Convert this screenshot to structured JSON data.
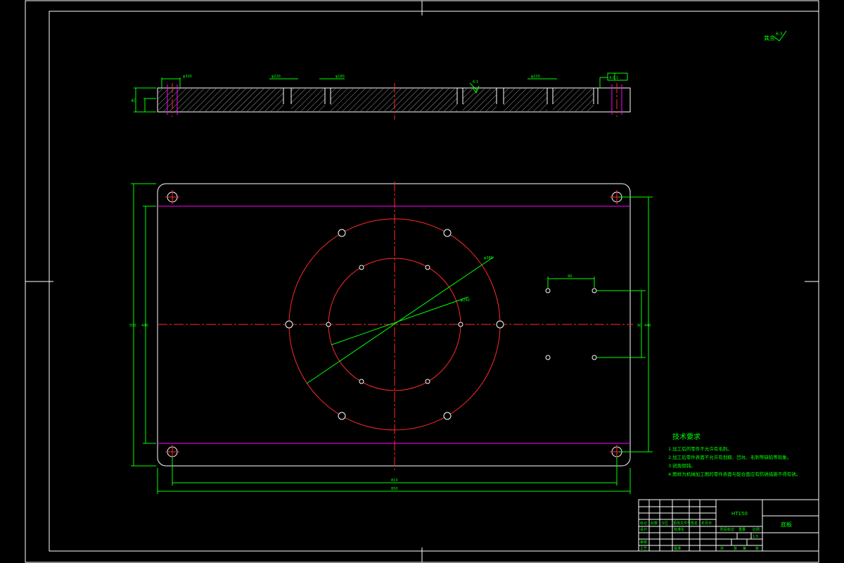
{
  "drawing": {
    "roughness_note": "其余",
    "roughness_value": "6.3",
    "datum_label": "A",
    "tolerance_labels": [
      "φ300",
      "φ220",
      "φ160",
      "6.3",
      "φ220",
      "A 0.1"
    ],
    "hole_dims": {
      "outer_circle": "φ380",
      "inner_circle": "φ240",
      "rect_hole_spacing": "90",
      "rect_hole_height": "90"
    },
    "overall_dims": {
      "width_inner": "810",
      "width_outer": "850",
      "height_left_outer": "500",
      "height_left_inner": "440",
      "height_right": "440"
    },
    "section_height": "40"
  },
  "tech_requirements": {
    "title": "技术要求",
    "items": [
      "1.加工后的零件不允许有毛刺。",
      "2.加工后零件表面不允许有划痕、凹坑、毛刺等缺陷等现象。",
      "3.锐角倒钝。",
      "4.图样为机械加工图的零件表面与配合面应有防锈措施不得有锈。"
    ]
  },
  "title_block": {
    "material": "HT150",
    "part_name": "底板",
    "row_labels": [
      "标记",
      "处数",
      "分区",
      "更改文件号",
      "签名",
      "年月日"
    ],
    "design": "设计",
    "standard": "标准化",
    "review": "审核",
    "process": "工艺",
    "approve": "批准",
    "stage": "阶段标记",
    "weight": "重量",
    "scale": "比例",
    "scale_value": "1:5",
    "sheet_total": "共",
    "sheet_num": "第",
    "sheet_unit": "张"
  }
}
